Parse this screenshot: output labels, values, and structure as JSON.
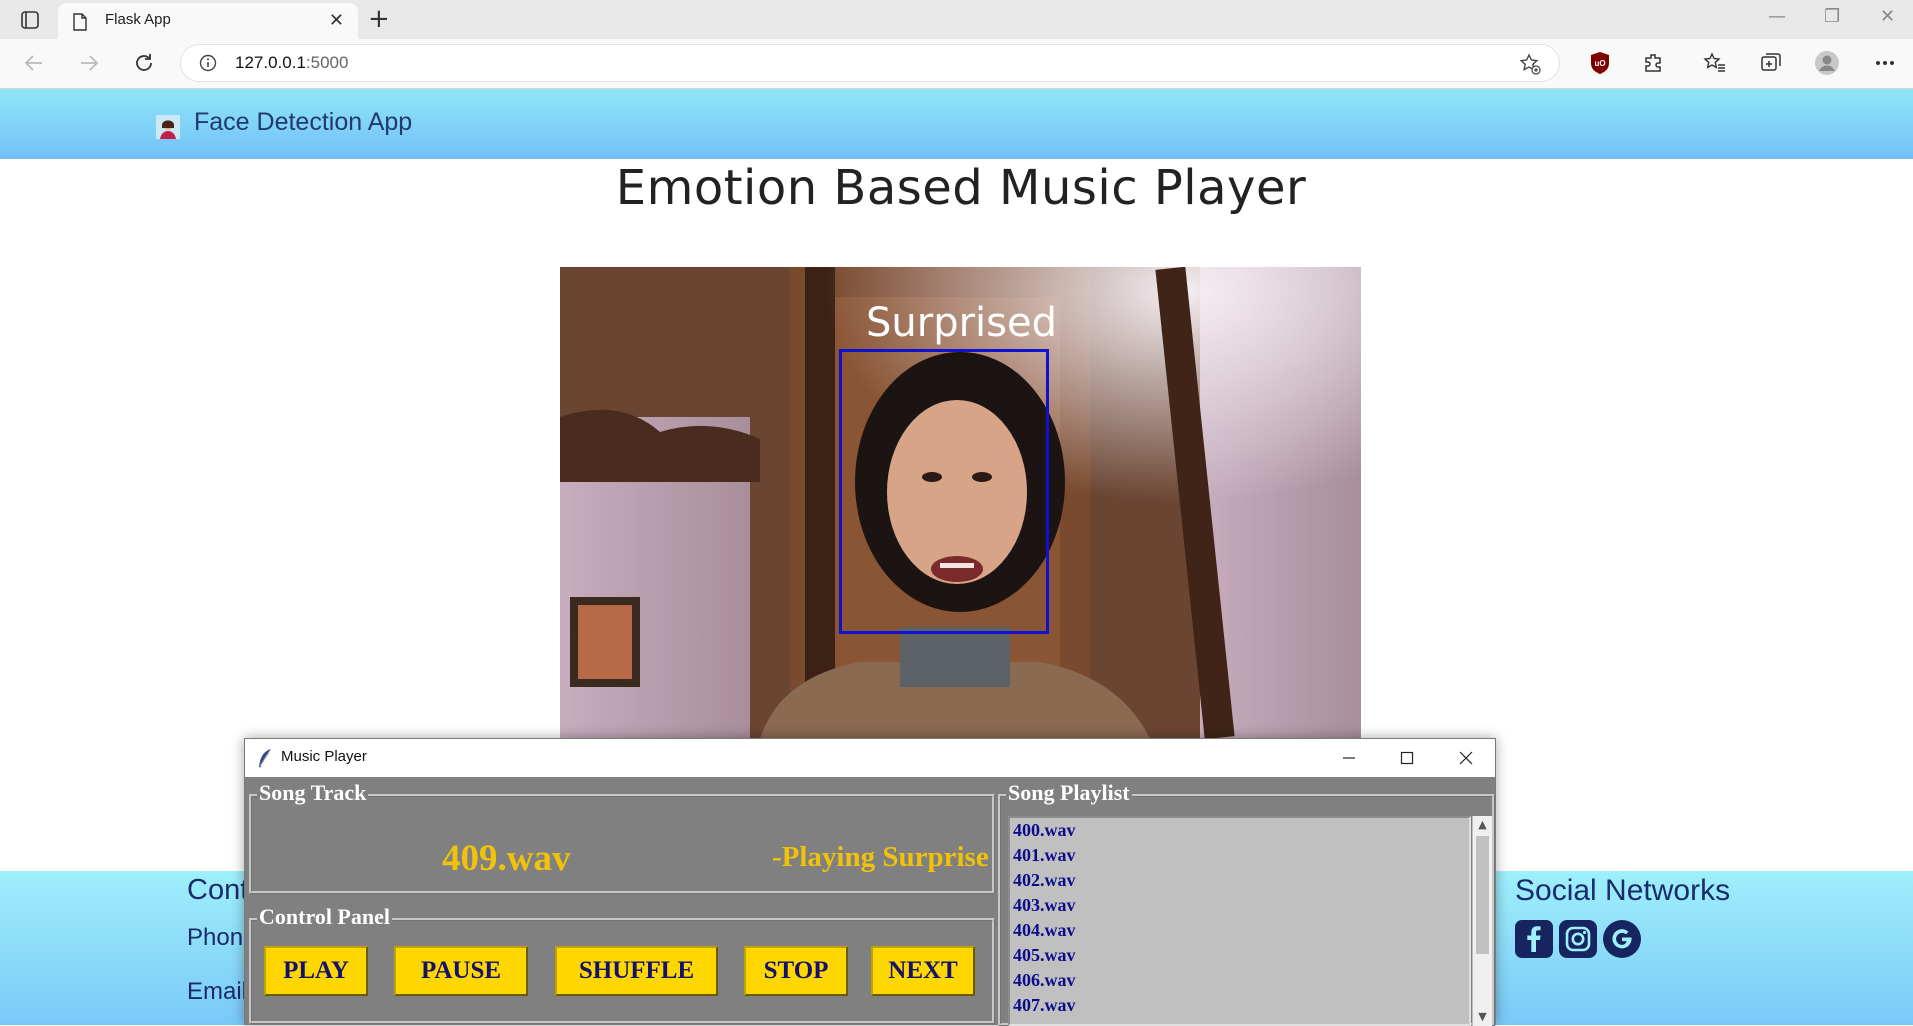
{
  "browser": {
    "tab_title": "Flask App",
    "address_host": "127.0.0.1",
    "address_port": ":5000"
  },
  "navbar": {
    "brand": "Face Detection App"
  },
  "page": {
    "title": "Emotion Based Music Player"
  },
  "camera": {
    "detected_emotion": "Surprised",
    "box_color": "#1010d0"
  },
  "footer": {
    "contact_heading": "Cont",
    "phone_label": "Phon",
    "email_label": "Email",
    "social_heading": "Social Networks",
    "social_icons": [
      "facebook-icon",
      "instagram-icon",
      "google-icon"
    ]
  },
  "music_player": {
    "window_title": "Music Player",
    "song_track_label": "Song Track",
    "current_track": "409.wav",
    "status": "-Playing Surprise",
    "control_panel_label": "Control Panel",
    "buttons": {
      "play": "PLAY",
      "pause": "PAUSE",
      "shuffle": "SHUFFLE",
      "stop": "STOP",
      "next": "NEXT"
    },
    "playlist_label": "Song Playlist",
    "playlist": [
      "400.wav",
      "401.wav",
      "402.wav",
      "403.wav",
      "404.wav",
      "405.wav",
      "406.wav",
      "407.wav"
    ]
  },
  "colors": {
    "navbar_gradient_top": "#8ee6f7",
    "navbar_gradient_bottom": "#74bff8",
    "button_yellow": "#ffd700",
    "track_yellow": "#f0c20a",
    "player_bg": "#808080",
    "playlist_bg": "#c0c0c0",
    "playlist_text": "#0b0b8c"
  }
}
